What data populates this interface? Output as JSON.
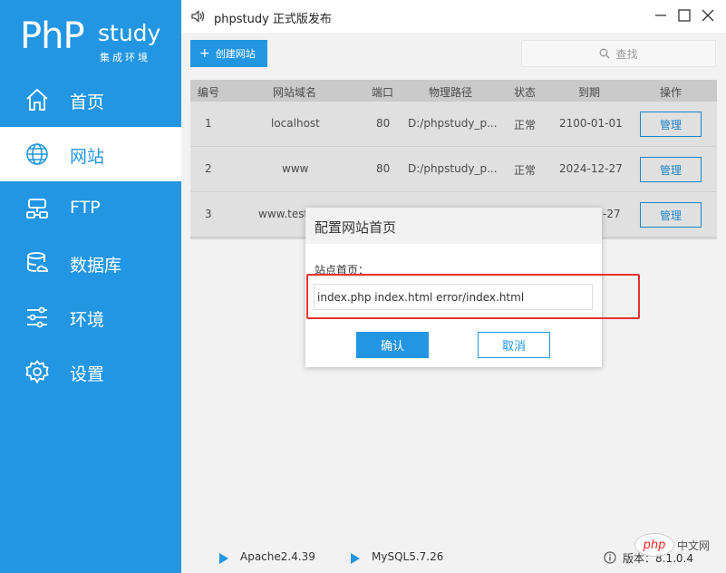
{
  "logo": {
    "php": "PhP",
    "study": "study",
    "subtitle": "集成环境"
  },
  "sidebar": {
    "items": [
      {
        "label": "首页",
        "icon": "home-icon"
      },
      {
        "label": "网站",
        "icon": "globe-icon",
        "active": true
      },
      {
        "label": "FTP",
        "icon": "ftp-server-icon"
      },
      {
        "label": "数据库",
        "icon": "database-icon"
      },
      {
        "label": "环境",
        "icon": "sliders-icon"
      },
      {
        "label": "设置",
        "icon": "gear-icon"
      }
    ]
  },
  "titlebar": {
    "title": "phpstudy 正式版发布",
    "icon": "speaker-icon"
  },
  "toolbar": {
    "create_label": "创建网站",
    "search_label": "查找"
  },
  "table": {
    "headers": [
      "编号",
      "网站域名",
      "端口",
      "物理路径",
      "状态",
      "到期",
      "操作"
    ],
    "rows": [
      {
        "id": "1",
        "domain": "localhost",
        "port": "80",
        "path": "D:/phpstudy_p...",
        "status": "正常",
        "expire": "2100-01-01",
        "action": "管理"
      },
      {
        "id": "2",
        "domain": "www",
        "port": "80",
        "path": "D:/phpstudy_p...",
        "status": "正常",
        "expire": "2024-12-27",
        "action": "管理"
      },
      {
        "id": "3",
        "domain": "www.test",
        "port": "",
        "path": "",
        "status": "",
        "expire": "-27",
        "action": "管理"
      }
    ]
  },
  "dialog": {
    "title": "配置网站首页",
    "field_label": "站点首页：",
    "field_value": "index.php index.html error/index.html",
    "ok_label": "确认",
    "cancel_label": "取消"
  },
  "statusbar": {
    "apache": "Apache2.4.39",
    "mysql": "MySQL5.7.26",
    "version": "版本：8.1.0.4"
  },
  "watermark": {
    "text": "php",
    "text2": "中文网"
  },
  "colors": {
    "accent": "#2296e3",
    "highlight": "#e53333"
  }
}
